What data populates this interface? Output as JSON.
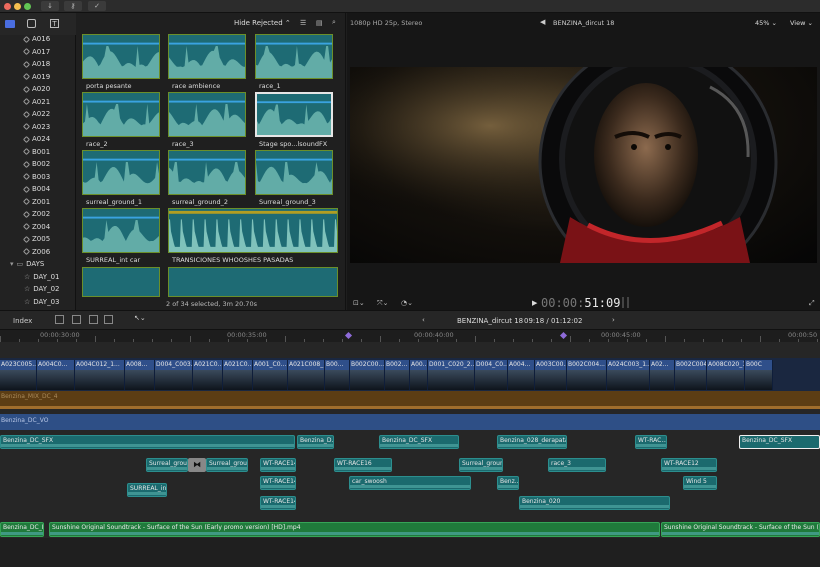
{
  "toolbar": {
    "buttons": [
      {
        "icon": "import-arrow-icon",
        "label": "↓"
      },
      {
        "icon": "key-icon",
        "label": "⚷"
      },
      {
        "icon": "checkmark-circle-icon",
        "label": "✓"
      }
    ]
  },
  "library": {
    "keywords": [
      "A016",
      "A017",
      "A018",
      "A019",
      "A020",
      "A021",
      "A022",
      "A023",
      "A024",
      "B001",
      "B002",
      "B003",
      "B004",
      "Z001",
      "Z002",
      "Z004",
      "Z005",
      "Z006"
    ],
    "folder": "DAYS",
    "days": [
      "DAY_01",
      "DAY_02",
      "DAY_03"
    ]
  },
  "browser": {
    "filter": "Hide Rejected",
    "clips": [
      {
        "label": "porta pesante"
      },
      {
        "label": "race ambience"
      },
      {
        "label": "race_1"
      },
      {
        "label": "race_2"
      },
      {
        "label": "race_3"
      },
      {
        "label": "Stage spo...lsoundFX"
      },
      {
        "label": "surreal_ground_1"
      },
      {
        "label": "surreal_ground_2"
      },
      {
        "label": "Surreal_ground_3"
      },
      {
        "label": "SURREAL_int car"
      },
      {
        "label": "TRANSICIONES WHOOSHES PASADAS"
      }
    ],
    "status": "2 of 34 selected, 3m 20.70s"
  },
  "viewer": {
    "format": "1080p HD 25p, Stereo",
    "title": "BENZINA_dircut 18",
    "zoom": "45%",
    "view": "View",
    "timecode_prefix": "00:00:",
    "timecode": "51:09"
  },
  "timeline": {
    "index": "Index",
    "project": "BENZINA_dircut 18",
    "duration": "09:18 / 01:12:02",
    "ruler": [
      "00:00:30:00",
      "00:00:35:00",
      "00:00:40:00",
      "00:00:45:00",
      "00:00:50"
    ],
    "video_clips": [
      "A023C005...",
      "A004C0...",
      "A004C012_1...",
      "A008...",
      "D004_C003...",
      "A021C0...",
      "A021C0...",
      "A001_C0...",
      "A021C008_1...",
      "B00...",
      "B002C00...",
      "B002...",
      "A00...",
      "D001_C020_2...",
      "D004_C0...",
      "A004...",
      "A003C00...",
      "B002C004...",
      "A024C003_1...",
      "A02...",
      "B002C004...",
      "A008C020_1...",
      "B00C"
    ],
    "audio_lanes": {
      "mix": "Benzina_MIX_DC_4",
      "vo": "Benzina_DC_VO",
      "sfx": [
        "Benzina_DC_SFX",
        "Benzina_D...",
        "Benzina_DC_SFX",
        "Benzina_028_derapata",
        "WT-RAC...",
        "Benzina_DC_SFX"
      ],
      "row2": [
        "Surreal_grou...",
        "Surreal_grou...",
        "WT-RACE14",
        "WT-RACE16",
        "Surreal_groun...",
        "race_3",
        "WT-RACE12"
      ],
      "row3": [
        "SURREAL_in...",
        "WT-RACE14",
        "car_swoosh",
        "Benz...",
        "Wind 5"
      ],
      "row4": [
        "WT-RACE14",
        "Benzina_020"
      ],
      "music": [
        "Benzina_DC_M...",
        "Sunshine Original Soundtrack - Surface of the Sun (Early promo version) [HD].mp4",
        "Sunshine Original Soundtrack - Surface of the Sun (Early promo version) [HD].mp4"
      ]
    }
  },
  "colors": {
    "audio_clip": "#1b6a6e",
    "music_clip": "#1f7a3b",
    "video_clip": "#2f4f8a",
    "accent": "#5b8fe6"
  }
}
